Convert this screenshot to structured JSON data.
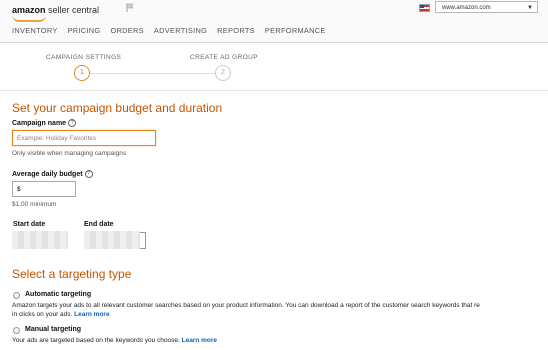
{
  "header": {
    "brand_amazon": "amazon",
    "brand_sc": " seller central",
    "nav": [
      "INVENTORY",
      "PRICING",
      "ORDERS",
      "ADVERTISING",
      "REPORTS",
      "PERFORMANCE"
    ],
    "marketplace": "www.amazon.com"
  },
  "steps": [
    {
      "label": "CAMPAIGN SETTINGS",
      "number": "1",
      "active": true
    },
    {
      "label": "CREATE AD GROUP",
      "number": "2",
      "active": false
    }
  ],
  "budget_section": {
    "heading": "Set your campaign budget and duration",
    "campaign_name_label": "Campaign name",
    "campaign_name_placeholder": "Example: Holiday Favorites",
    "campaign_name_hint": "Only visible when managing campaigns",
    "daily_budget_label": "Average daily budget",
    "daily_budget_value": "$",
    "daily_budget_hint": "$1.00 minimum",
    "start_date_label": "Start date",
    "end_date_label": "End date"
  },
  "targeting_section": {
    "heading": "Select a targeting type",
    "automatic_label": "Automatic targeting",
    "automatic_desc_line1": "Amazon targets your ads to all relevant customer searches based on your product information. You can download a report of the customer search keywords that re",
    "automatic_desc_line2": "in clicks on your ads.",
    "automatic_link": "Learn more",
    "manual_label": "Manual targeting",
    "manual_desc": "Your ads are targeted based on the keywords you choose.",
    "manual_link": "Learn more"
  },
  "colors": {
    "accent": "#e4881f",
    "heading": "#c45500",
    "link": "#0066c0"
  }
}
